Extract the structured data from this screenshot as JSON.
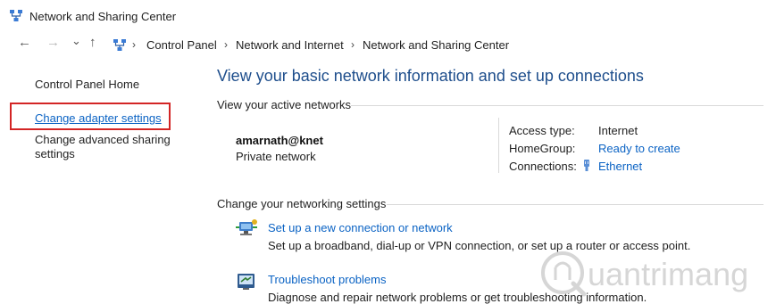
{
  "window": {
    "title": "Network and Sharing Center"
  },
  "nav": {
    "back": "←",
    "forward": "→",
    "recent": "⌄",
    "up": "↑",
    "breadcrumb": [
      "Control Panel",
      "Network and Internet",
      "Network and Sharing Center"
    ],
    "separator": "›"
  },
  "sidebar": {
    "home": "Control Panel Home",
    "change_adapter": "Change adapter settings",
    "change_sharing_line1": "Change advanced sharing",
    "change_sharing_line2": "settings"
  },
  "main": {
    "heading": "View your basic network information and set up connections",
    "active_title": "View your active networks",
    "network_name": "amarnath@knet",
    "network_type": "Private network",
    "access_label": "Access type:",
    "access_value": "Internet",
    "homegroup_label": "HomeGroup:",
    "homegroup_value": "Ready to create",
    "connections_label": "Connections:",
    "connections_value": "Ethernet",
    "change_title": "Change your networking settings",
    "tasks": [
      {
        "title": "Set up a new connection or network",
        "desc": "Set up a broadband, dial-up or VPN connection, or set up a router or access point."
      },
      {
        "title": "Troubleshoot problems",
        "desc": "Diagnose and repair network problems or get troubleshooting information."
      }
    ]
  },
  "watermark": {
    "text": "uantrimang"
  },
  "colors": {
    "link": "#0b63c4",
    "heading": "#1e4e8c",
    "highlight": "#d32525"
  }
}
